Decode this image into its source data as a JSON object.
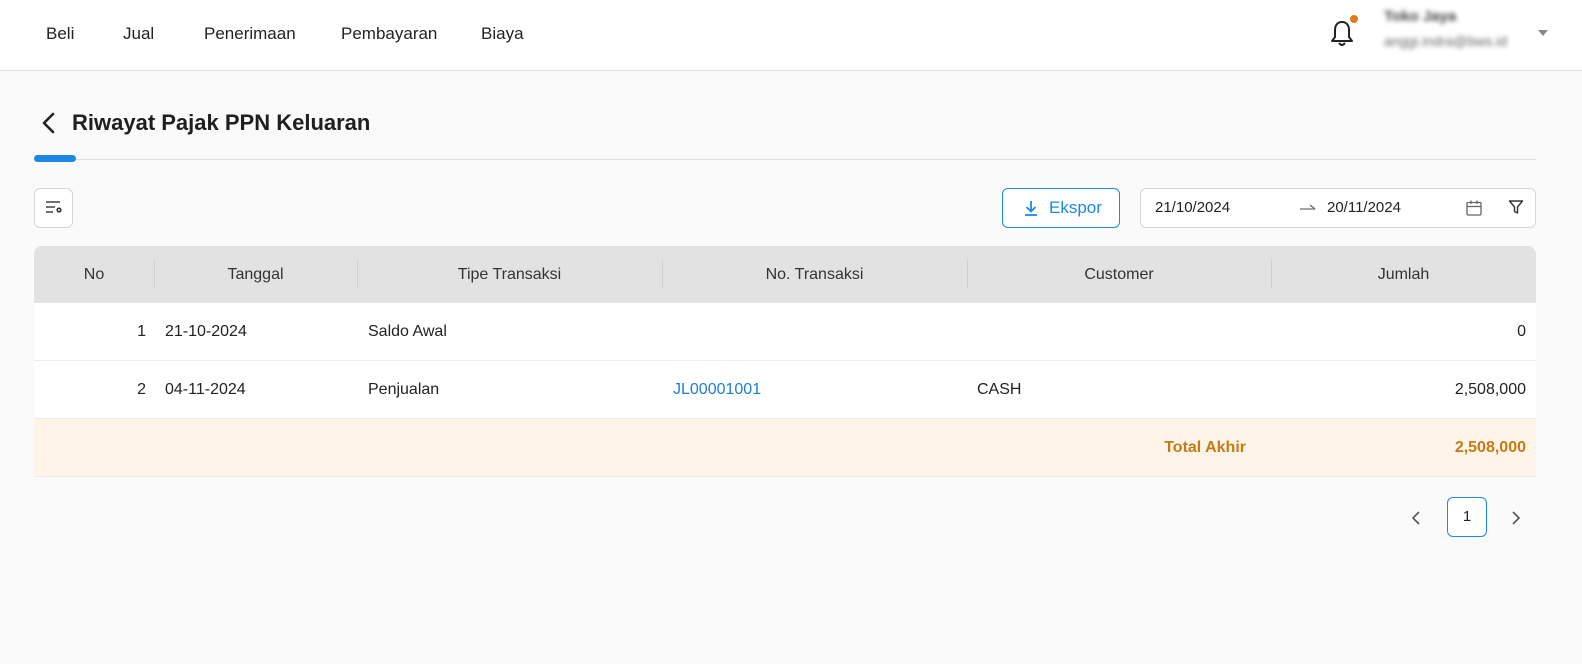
{
  "nav": {
    "items": [
      "Beli",
      "Jual",
      "Penerimaan",
      "Pembayaran",
      "Biaya"
    ]
  },
  "user": {
    "name": "Toko Jaya",
    "email": "anggi.indra@bws.id"
  },
  "page": {
    "title": "Riwayat Pajak PPN Keluaran"
  },
  "toolbar": {
    "export_label": "Ekspor",
    "date_start": "21/10/2024",
    "date_end": "20/11/2024"
  },
  "table": {
    "headers": [
      "No",
      "Tanggal",
      "Tipe Transaksi",
      "No. Transaksi",
      "Customer",
      "Jumlah"
    ],
    "rows": [
      {
        "no": "1",
        "date": "21-10-2024",
        "type": "Saldo Awal",
        "trx": "",
        "customer": "",
        "amount": "0"
      },
      {
        "no": "2",
        "date": "04-11-2024",
        "type": "Penjualan",
        "trx": "JL00001001",
        "customer": "CASH",
        "amount": "2,508,000"
      }
    ],
    "total_label": "Total Akhir",
    "total_amount": "2,508,000"
  },
  "pagination": {
    "current_page": "1"
  },
  "colors": {
    "accent": "#1e88e5",
    "total_text": "#c67a16",
    "total_bg": "#fef5e8",
    "notification_dot": "#e07a1a"
  }
}
